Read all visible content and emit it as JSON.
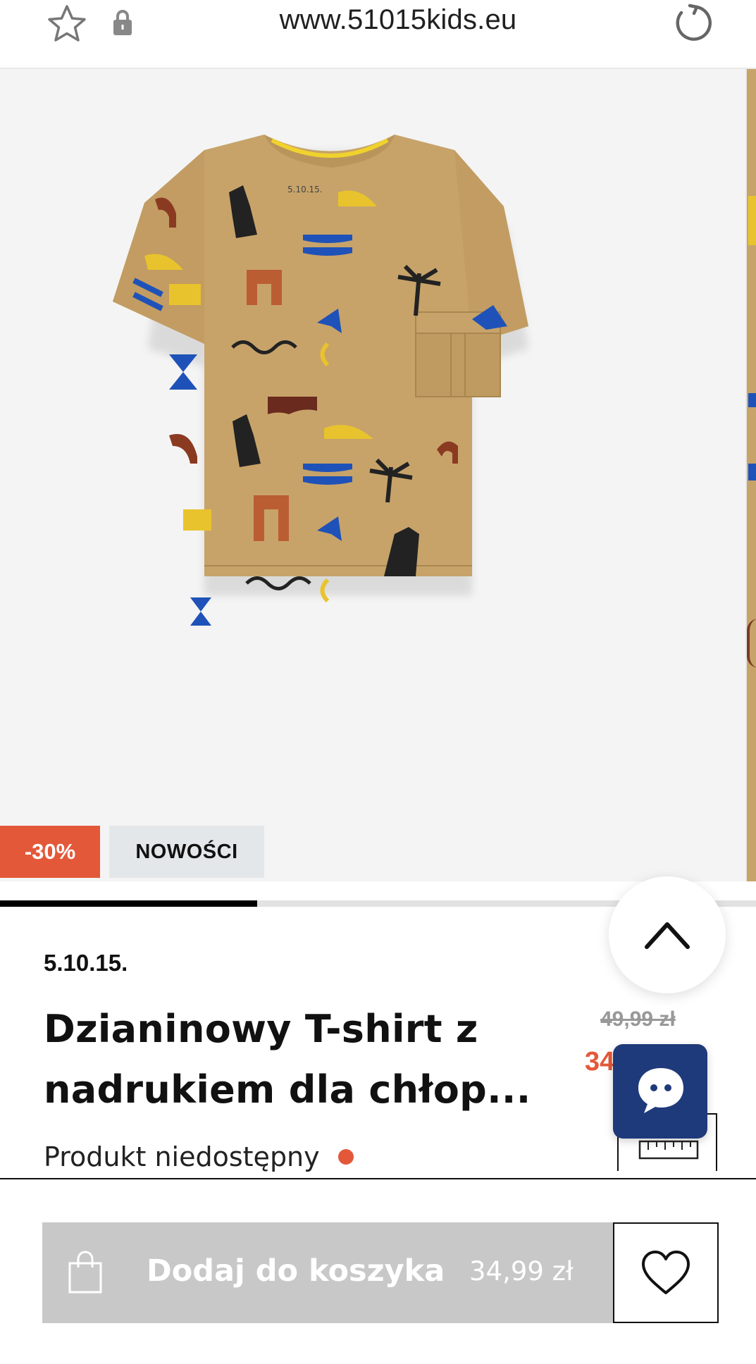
{
  "browser": {
    "url": "www.51015kids.eu"
  },
  "product": {
    "badges": {
      "discount": "-30%",
      "new": "NOWOŚCI"
    },
    "gallery": {
      "progress": 0.34
    },
    "brand": "5.10.15.",
    "title_line1": "Dzianinowy T-shirt z",
    "title_line2": "nadrukiem dla chłop...",
    "old_price": "49,99 zł",
    "new_price": "34,99 zł",
    "availability": "Produkt niedostępny"
  },
  "actions": {
    "add_to_cart_label": "Dodaj do koszyka",
    "add_to_cart_price": "34,99 zł"
  },
  "colors": {
    "accent": "#e4583a",
    "chat": "#1f3a7a",
    "disabled_button": "#c8c8c8",
    "shirt": "#c7a36a"
  },
  "icons": {
    "star": "star-icon",
    "lock": "lock-icon",
    "reload": "reload-icon",
    "scroll_up": "chevron-up-icon",
    "chat": "chat-bubble-icon",
    "size_guide": "ruler-icon",
    "bag": "shopping-bag-icon",
    "wishlist": "heart-icon"
  }
}
